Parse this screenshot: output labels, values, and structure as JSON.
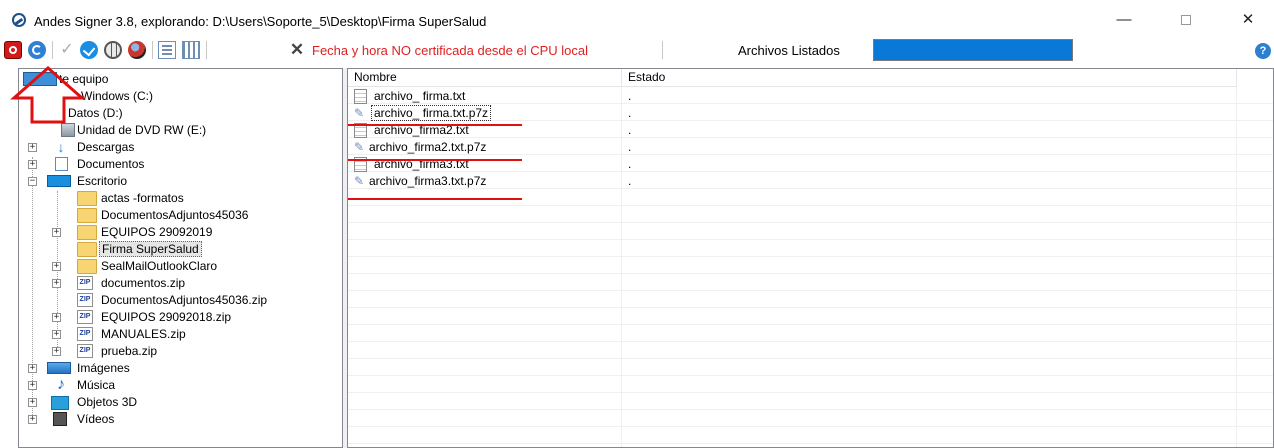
{
  "window": {
    "title": "Andes Signer 3.8, explorando: D:\\Users\\Soporte_5\\Desktop\\Firma SuperSalud",
    "minimize": "—",
    "maximize": "",
    "close": "✕"
  },
  "toolbar": {
    "certificate_warning": "Fecha y hora NO certificada desde el CPU local",
    "listed_label": "Archivos Listados",
    "help": "?",
    "icons": [
      "stop-icon",
      "refresh-icon",
      "check-gray-icon",
      "check-blue-icon",
      "globe-icon",
      "ball-icon",
      "list-view-icon",
      "detail-view-icon",
      "tools-icon"
    ],
    "warning_color": "#e02020",
    "progress_color": "#0a78d7",
    "progress_fraction": 1.0
  },
  "tree": {
    "root": "Este equipo",
    "root_visible": "te equipo",
    "drives": [
      {
        "label": "Windows (C:)",
        "visible": "Windows (C:)"
      },
      {
        "label": "Datos (D:)",
        "visible": "Datos (D:)"
      },
      {
        "label": "Unidad de DVD RW (E:)",
        "visible": "Unidad de DVD RW (E:)"
      }
    ],
    "folders": [
      "Descargas",
      "Documentos",
      "Escritorio"
    ],
    "desktop_children": [
      "actas -formatos",
      "DocumentosAdjuntos45036",
      "EQUIPOS 29092019",
      "Firma SuperSalud",
      "SealMailOutlookClaro",
      "documentos.zip",
      "DocumentosAdjuntos45036.zip",
      "EQUIPOS 29092018.zip",
      "MANUALES.zip",
      "prueba.zip"
    ],
    "other_folders": [
      "Imágenes",
      "Música",
      "Objetos 3D",
      "Vídeos"
    ],
    "selected": "Firma SuperSalud",
    "zip_tag": "ZIP"
  },
  "list": {
    "columns": [
      "Nombre",
      "Estado"
    ],
    "files": [
      {
        "name": "archivo_ firma.txt",
        "type": "txt",
        "state": "."
      },
      {
        "name": "archivo_ firma.txt.p7z",
        "type": "p7z",
        "state": "."
      },
      {
        "name": "archivo_firma2.txt",
        "type": "txt",
        "state": "."
      },
      {
        "name": "archivo_firma2.txt.p7z",
        "type": "p7z",
        "state": "."
      },
      {
        "name": "archivo_firma3.txt",
        "type": "txt",
        "state": "."
      },
      {
        "name": "archivo_firma3.txt.p7z",
        "type": "p7z",
        "state": "."
      }
    ],
    "highlight_color": "#e01010"
  },
  "annotation": {
    "arrow_color": "#e01010",
    "points_to": "refresh-icon"
  }
}
